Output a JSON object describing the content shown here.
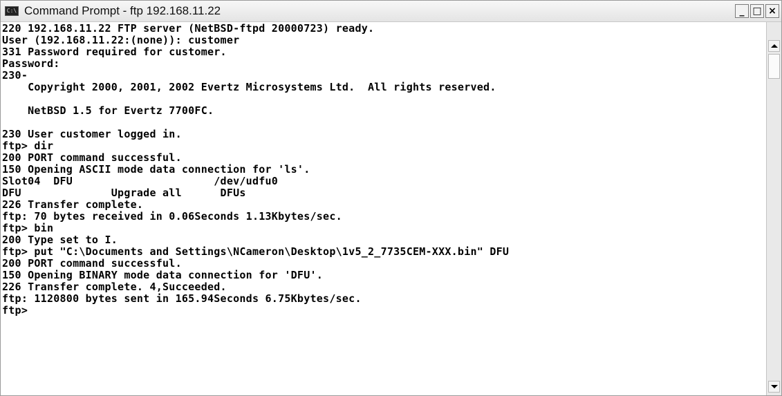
{
  "window": {
    "title": "Command Prompt - ftp 192.168.11.22",
    "icon": "console-icon",
    "icon_label": "C:\\",
    "minimize_label": "_",
    "maximize_label": "□",
    "close_label": "×"
  },
  "console": {
    "lines": [
      "220 192.168.11.22 FTP server (NetBSD-ftpd 20000723) ready.",
      "User (192.168.11.22:(none)): customer",
      "331 Password required for customer.",
      "Password:",
      "230-",
      "    Copyright 2000, 2001, 2002 Evertz Microsystems Ltd.  All rights reserved.",
      "",
      "    NetBSD 1.5 for Evertz 7700FC.",
      "",
      "230 User customer logged in.",
      "ftp> dir",
      "200 PORT command successful.",
      "150 Opening ASCII mode data connection for 'ls'.",
      "Slot04  DFU                      /dev/udfu0",
      "DFU              Upgrade all      DFUs",
      "226 Transfer complete.",
      "ftp: 70 bytes received in 0.06Seconds 1.13Kbytes/sec.",
      "ftp> bin",
      "200 Type set to I.",
      "ftp> put \"C:\\Documents and Settings\\NCameron\\Desktop\\1v5_2_7735CEM-XXX.bin\" DFU",
      "200 PORT command successful.",
      "150 Opening BINARY mode data connection for 'DFU'.",
      "226 Transfer complete. 4,Succeeded.",
      "ftp: 1120800 bytes sent in 165.94Seconds 6.75Kbytes/sec.",
      "ftp>"
    ]
  }
}
